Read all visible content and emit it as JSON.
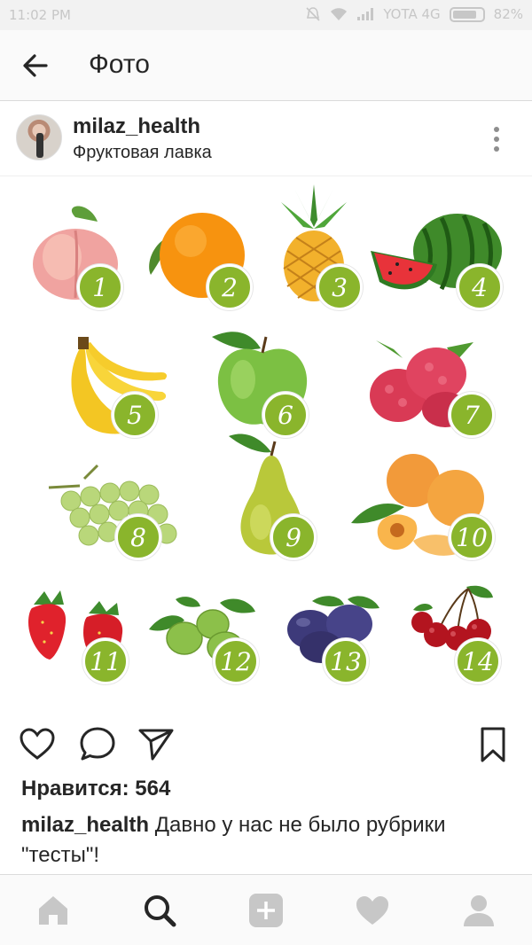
{
  "status_bar": {
    "time": "11:02 PM",
    "carrier": "YOTA 4G",
    "battery": "82%",
    "battery_level": 0.82
  },
  "appbar": {
    "title": "Фото",
    "icons": {
      "back": "arrow-left-icon"
    }
  },
  "post": {
    "username": "milaz_health",
    "location": "Фруктовая лавка",
    "likes_label": "Нравится: 564",
    "caption_user": "milaz_health",
    "caption_text": " Давно у нас не было рубрики \"тесты\"!",
    "fruits": [
      {
        "number": "1",
        "name": "peach"
      },
      {
        "number": "2",
        "name": "orange"
      },
      {
        "number": "3",
        "name": "pineapple"
      },
      {
        "number": "4",
        "name": "watermelon"
      },
      {
        "number": "5",
        "name": "banana"
      },
      {
        "number": "6",
        "name": "green-apple"
      },
      {
        "number": "7",
        "name": "raspberry"
      },
      {
        "number": "8",
        "name": "grapes"
      },
      {
        "number": "9",
        "name": "pear"
      },
      {
        "number": "10",
        "name": "apricot"
      },
      {
        "number": "11",
        "name": "strawberry"
      },
      {
        "number": "12",
        "name": "gooseberry"
      },
      {
        "number": "13",
        "name": "plum"
      },
      {
        "number": "14",
        "name": "cherry"
      }
    ]
  },
  "actions": {
    "icons": [
      "heart-icon",
      "comment-icon",
      "share-icon",
      "bookmark-icon"
    ]
  },
  "bottom_nav": {
    "icons": [
      "home-icon",
      "search-icon",
      "add-icon",
      "activity-heart-icon",
      "profile-icon"
    ],
    "active": "search-icon"
  },
  "colors": {
    "badge_green": "#8ab52c",
    "text": "#262626",
    "nav_inactive": "#c7c7c7"
  }
}
